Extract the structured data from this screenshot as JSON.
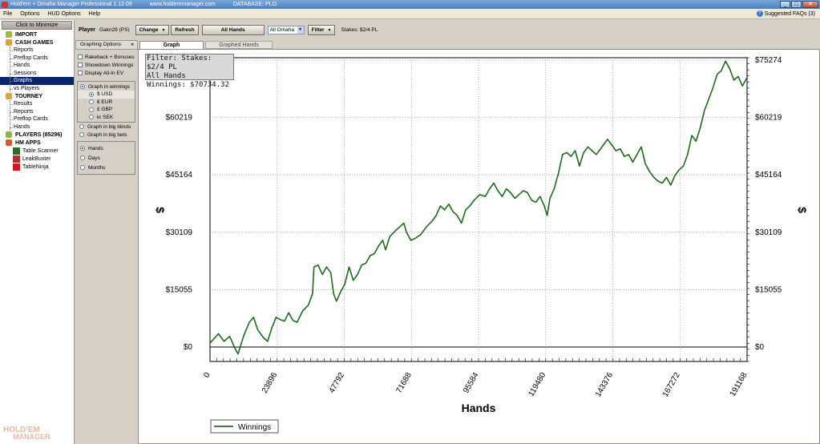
{
  "window": {
    "title": "Hold'em + Omaha Manager Professional 1.12.09",
    "url": "www.holdemmanager.com",
    "database": "DATABASE: PLO"
  },
  "menu": {
    "items": [
      "File",
      "Options",
      "HUD Options",
      "Help"
    ],
    "faq": "Suggested FAQs (3)"
  },
  "sidebar": {
    "minimize": "Click to Minimize",
    "import": "IMPORT",
    "cash_games": "CASH GAMES",
    "cash_items": [
      "Reports",
      "Preflop Cards",
      "Hands",
      "Sessions",
      "Graphs",
      "vs Players"
    ],
    "tourney": "TOURNEY",
    "tourney_items": [
      "Results",
      "Reports",
      "Preflop Cards",
      "Hands"
    ],
    "players": "PLAYERS (85296)",
    "hm_apps": "HM APPS",
    "apps": [
      "Table Scanner",
      "LeakBuster",
      "TableNinja"
    ],
    "logo_line1": "HOLD'EM",
    "logo_line2": "MANAGER"
  },
  "toolbar": {
    "player_label": "Player",
    "player_name": "Gakn29 (PS)",
    "change": "Change",
    "refresh": "Refresh",
    "all_hands": "All Hands",
    "game_select": "All Omaha",
    "filter": "Filter",
    "stakes": "Stakes: $2/4 PL"
  },
  "graph_options": {
    "header": "Graphing Options",
    "checks": [
      "Rakeback + Bonuses",
      "Showdown Winnings",
      "Display All-In EV"
    ],
    "graph_winnings": "Graph in winnings",
    "currencies": [
      "$ USD",
      "€ EUR",
      "£ GBP",
      "kr SEK"
    ],
    "graph_bb": "Graph in big blinds",
    "graph_bets": "Graph in big bets",
    "x_options": [
      "Hands",
      "Days",
      "Months"
    ]
  },
  "tabs": [
    "Graph",
    "Graphed Hands"
  ],
  "infobox": {
    "line1": "Filter: Stakes: $2/4 PL",
    "line2": "All Hands",
    "line3": "Winnings: $70734.32"
  },
  "chart_data": {
    "type": "line",
    "xlabel": "Hands",
    "ylabel": "$",
    "x_ticks": [
      0,
      23896,
      47792,
      71688,
      95584,
      119480,
      143376,
      167272,
      191168
    ],
    "y_ticks": [
      "$0",
      "$15055",
      "$30109",
      "$45164",
      "$60219",
      "$75274"
    ],
    "y_values": [
      0,
      15055,
      30109,
      45164,
      60219,
      75274
    ],
    "xlim": [
      0,
      191168
    ],
    "ylim": [
      -2500,
      75274
    ],
    "legend": "Winnings",
    "legend_position": "bottom-left",
    "grid": true,
    "line_color": "#1f6b1f",
    "series": [
      {
        "name": "Winnings",
        "points": [
          [
            0,
            1000
          ],
          [
            3000,
            3500
          ],
          [
            5000,
            1500
          ],
          [
            7000,
            2800
          ],
          [
            9000,
            -500
          ],
          [
            10000,
            -1800
          ],
          [
            12000,
            3000
          ],
          [
            14000,
            6500
          ],
          [
            15500,
            7800
          ],
          [
            17000,
            4500
          ],
          [
            19000,
            2500
          ],
          [
            20500,
            1500
          ],
          [
            22000,
            5000
          ],
          [
            23500,
            7800
          ],
          [
            25000,
            7200
          ],
          [
            26500,
            6800
          ],
          [
            28000,
            9000
          ],
          [
            29500,
            7000
          ],
          [
            31000,
            6500
          ],
          [
            33000,
            9500
          ],
          [
            35000,
            11000
          ],
          [
            36500,
            14000
          ],
          [
            37000,
            21000
          ],
          [
            38500,
            21500
          ],
          [
            40000,
            19000
          ],
          [
            41500,
            21000
          ],
          [
            43000,
            19500
          ],
          [
            44000,
            14000
          ],
          [
            45000,
            12000
          ],
          [
            46500,
            14500
          ],
          [
            48000,
            16500
          ],
          [
            49500,
            21000
          ],
          [
            51000,
            17500
          ],
          [
            52500,
            19000
          ],
          [
            54000,
            21500
          ],
          [
            55500,
            22000
          ],
          [
            57000,
            24000
          ],
          [
            58500,
            24500
          ],
          [
            60000,
            26500
          ],
          [
            61500,
            28000
          ],
          [
            62500,
            25500
          ],
          [
            64000,
            29000
          ],
          [
            66000,
            30500
          ],
          [
            67500,
            31500
          ],
          [
            69000,
            32500
          ],
          [
            70000,
            30000
          ],
          [
            71500,
            28000
          ],
          [
            73000,
            28500
          ],
          [
            75000,
            29500
          ],
          [
            77000,
            31500
          ],
          [
            79000,
            33000
          ],
          [
            80500,
            34500
          ],
          [
            82000,
            37000
          ],
          [
            83500,
            36000
          ],
          [
            85000,
            37500
          ],
          [
            86500,
            35500
          ],
          [
            88000,
            34500
          ],
          [
            89500,
            32500
          ],
          [
            91000,
            36000
          ],
          [
            92500,
            37000
          ],
          [
            94000,
            38500
          ],
          [
            96000,
            40000
          ],
          [
            98000,
            39500
          ],
          [
            99500,
            41500
          ],
          [
            101000,
            43000
          ],
          [
            102500,
            41000
          ],
          [
            104000,
            39500
          ],
          [
            105500,
            41500
          ],
          [
            107000,
            40500
          ],
          [
            108500,
            39000
          ],
          [
            110000,
            40000
          ],
          [
            111500,
            41000
          ],
          [
            113000,
            40500
          ],
          [
            114500,
            38500
          ],
          [
            116000,
            38000
          ],
          [
            117500,
            39500
          ],
          [
            119000,
            37000
          ],
          [
            120000,
            34500
          ],
          [
            121000,
            39000
          ],
          [
            122500,
            41500
          ],
          [
            124000,
            45500
          ],
          [
            125500,
            50500
          ],
          [
            127000,
            51000
          ],
          [
            128500,
            50000
          ],
          [
            130000,
            51500
          ],
          [
            131500,
            47500
          ],
          [
            133000,
            51000
          ],
          [
            134500,
            52500
          ],
          [
            136000,
            51500
          ],
          [
            137500,
            50500
          ],
          [
            139000,
            52000
          ],
          [
            140500,
            53500
          ],
          [
            141500,
            54500
          ],
          [
            143000,
            53000
          ],
          [
            144500,
            51500
          ],
          [
            146000,
            52000
          ],
          [
            147500,
            50000
          ],
          [
            149000,
            50500
          ],
          [
            150500,
            48500
          ],
          [
            152000,
            50500
          ],
          [
            153500,
            52500
          ],
          [
            155000,
            48000
          ],
          [
            156500,
            46000
          ],
          [
            158000,
            44500
          ],
          [
            159500,
            43500
          ],
          [
            161000,
            43000
          ],
          [
            162500,
            44500
          ],
          [
            164000,
            42500
          ],
          [
            165500,
            45000
          ],
          [
            167000,
            46500
          ],
          [
            168500,
            47500
          ],
          [
            170000,
            50500
          ],
          [
            171500,
            55500
          ],
          [
            173000,
            54000
          ],
          [
            174500,
            57500
          ],
          [
            176000,
            62000
          ],
          [
            177500,
            65000
          ],
          [
            179000,
            68000
          ],
          [
            180500,
            71500
          ],
          [
            182000,
            72500
          ],
          [
            183500,
            75000
          ],
          [
            185000,
            73000
          ],
          [
            186500,
            70000
          ],
          [
            188000,
            71000
          ],
          [
            189500,
            68500
          ],
          [
            191168,
            70734
          ]
        ]
      }
    ]
  }
}
